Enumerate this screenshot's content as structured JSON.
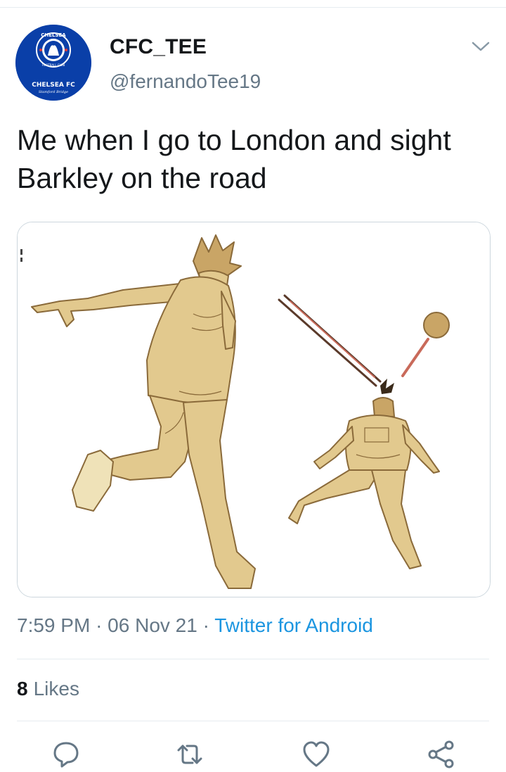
{
  "user": {
    "display_name": "CFC_TEE",
    "handle": "@fernandoTee19",
    "avatar": {
      "badge_top": "CHELSEA",
      "badge_bottom": "FOOTBALL CLUB",
      "title": "CHELSEA FC",
      "subtitle": "Stamford Bridge",
      "color": "#0a3fa8"
    }
  },
  "tweet": {
    "text": "Me when I go to London and sight Barkley on the road",
    "time": "7:59 PM",
    "date": "06 Nov 21",
    "separator": "·",
    "source": "Twitter for Android",
    "image_alt_icon": "meme-image"
  },
  "stats": {
    "likes_count": "8",
    "likes_label": "Likes"
  },
  "actions": {
    "reply_icon": "reply-icon",
    "retweet_icon": "retweet-icon",
    "like_icon": "heart-icon",
    "share_icon": "share-icon"
  },
  "colors": {
    "text": "#14171a",
    "secondary": "#657786",
    "link": "#1b95e0",
    "divider": "#e6ecf0",
    "figure_fill": "#e2c98e",
    "figure_stroke": "#8a6a3a"
  }
}
